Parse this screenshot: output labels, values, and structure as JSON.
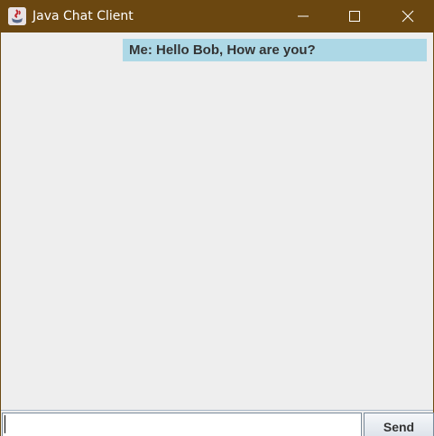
{
  "window": {
    "title": "Java Chat Client",
    "app_icon": "java-cup-icon",
    "controls": [
      "minimize-icon",
      "maximize-icon",
      "close-icon"
    ],
    "titlebar_color": "#6b4710"
  },
  "chat": {
    "messages": [
      {
        "text": "Me: Hello Bob, How are you?",
        "background": "#add8e6"
      }
    ]
  },
  "composer": {
    "input_value": "",
    "send_label": "Send"
  }
}
